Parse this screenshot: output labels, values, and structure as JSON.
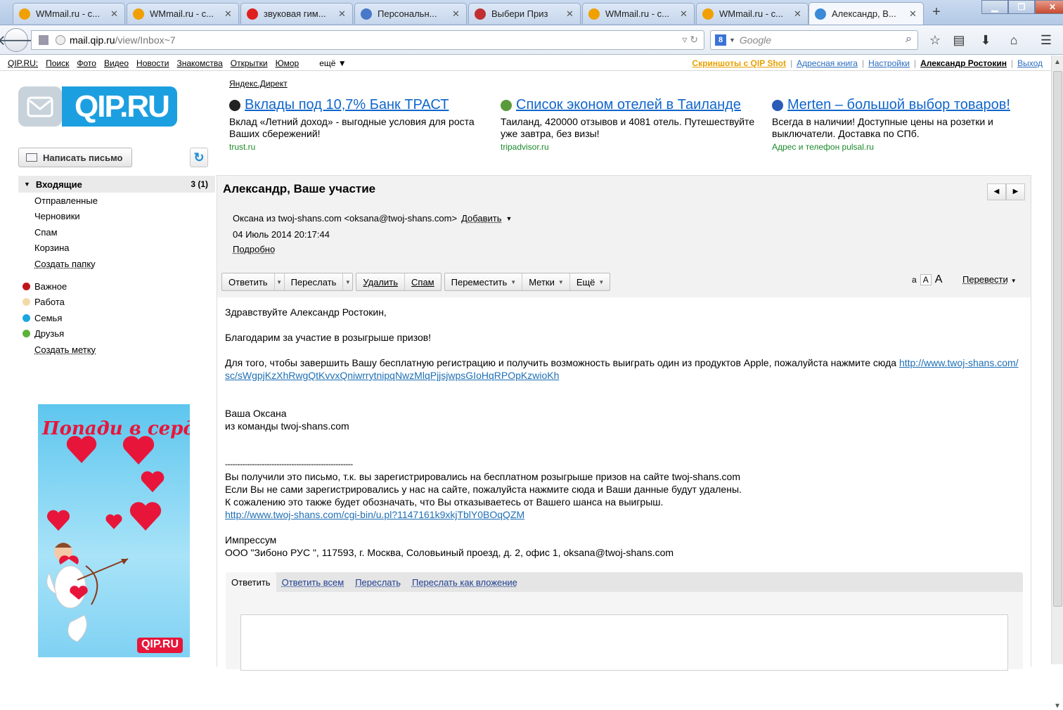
{
  "browser": {
    "tabs": [
      {
        "label": "WMmail.ru - с...",
        "icon": "wmmail-icon",
        "color": "#f0a000"
      },
      {
        "label": "WMmail.ru - с...",
        "icon": "wmmail-icon",
        "color": "#f0a000"
      },
      {
        "label": "звуковая гим...",
        "icon": "yandex-icon",
        "color": "#e02020"
      },
      {
        "label": "Персональн...",
        "icon": "personal-icon",
        "color": "#4a78c8"
      },
      {
        "label": "Выбери Приз",
        "icon": "prize-icon",
        "color": "#c03030"
      },
      {
        "label": "WMmail.ru - с...",
        "icon": "wmmail-icon",
        "color": "#f0a000"
      },
      {
        "label": "WMmail.ru - с...",
        "icon": "wmmail-icon",
        "color": "#f0a000"
      },
      {
        "label": "Александр, В...",
        "icon": "mail-icon",
        "color": "#3a8ad8",
        "active": true
      }
    ],
    "url_domain": "mail.qip.ru",
    "url_path": "/view/Inbox~7",
    "search_engine": "Google"
  },
  "topnav": {
    "left": [
      "QIP.RU:",
      "Поиск",
      "Фото",
      "Видео",
      "Новости",
      "Знакомства",
      "Открытки",
      "Юмор",
      "ещё ▼"
    ],
    "right": {
      "screenshots": "Скриншоты с QIP Shot",
      "addressbook": "Адресная книга",
      "settings": "Настройки",
      "user": "Александр Ростокин",
      "logout": "Выход"
    }
  },
  "logo": {
    "text": "QIP.RU"
  },
  "sidebar": {
    "compose": "Написать письмо",
    "inbox": {
      "label": "Входящие",
      "count": "3 (1)"
    },
    "folders": [
      "Отправленные",
      "Черновики",
      "Спам",
      "Корзина"
    ],
    "create_folder": "Создать папку",
    "labels": [
      {
        "name": "Важное",
        "color": "#c0141c"
      },
      {
        "name": "Работа",
        "color": "#f4d9a8"
      },
      {
        "name": "Семья",
        "color": "#1ca6e0"
      },
      {
        "name": "Друзья",
        "color": "#5cb338"
      }
    ],
    "create_label": "Создать метку",
    "promo_title": "Попади в сердце",
    "promo_logo": "QIP.RU"
  },
  "ads": {
    "header": "Яндекс.Директ",
    "items": [
      {
        "title": "Вклады под 10,7% Банк ТРАСТ",
        "text": "Вклад «Летний доход» - выгодные условия для роста Ваших сбережений!",
        "url": "trust.ru",
        "icon_color": "#222"
      },
      {
        "title": "Список эконом отелей в Таиланде",
        "text": "Таиланд, 420000 отзывов и 4081 отель. Путешествуйте уже завтра, без визы!",
        "url": "tripadvisor.ru",
        "icon_color": "#5a9a3a"
      },
      {
        "title": "Merten – большой выбор товаров!",
        "text": "Всегда в наличии! Доступные цены на розетки и выключатели. Доставка по СПб.",
        "url": "Адрес и телефон  pulsal.ru",
        "icon_color": "#2a5cb8"
      }
    ]
  },
  "message": {
    "subject": "Александр, Ваше участие",
    "sender": "Оксана из twoj-shans.com <oksana@twoj-shans.com>",
    "add_contact": "Добавить",
    "date": "04 Июль 2014 20:17:44",
    "details": "Подробно",
    "toolbar": {
      "reply": "Ответить",
      "forward": "Переслать",
      "delete": "Удалить",
      "spam": "Спам",
      "move": "Переместить",
      "tags": "Метки",
      "more": "Ещё"
    },
    "font_small": "а",
    "font_mid": "А",
    "font_large": "А",
    "translate": "Перевести",
    "body": {
      "greeting": "Здравствуйте Александр Ростокин,",
      "thanks": "Благодарим за участие в розыгрыше призов!",
      "instruction": "Для того, чтобы завершить Вашу бесплатную регистрацию и получить возможность выиграть один из продуктов Apple, пожалуйста нажмите сюда ",
      "link1": "http://www.twoj-shans.com/sc/sWgpjKzXhRwgQtKvvxQniwrrytnipqNwzMlqPjjsjwpsGIoHqRPOpKzwioKh",
      "sign1": "Ваша Оксана",
      "sign2": "из команды twoj-shans.com",
      "separator": "----------------------------------------------------",
      "footer1": "Вы получили это письмо, т.к. вы зарегистрировались на бесплатном розыгрыше призов на сайте twoj-shans.com",
      "footer2": "Если Вы не сами зарегистрировались у нас на сайте, пожалуйста нажмите сюда и Ваши данные будут удалены.",
      "footer3": "К сожалению это также будет обозначать, что Вы отказываетесь от Вашего шанса на выигрыш.",
      "link2": "http://www.twoj-shans.com/cgi-bin/u.pl?1147161k9xkjTblY0BOqQZM",
      "impressum": "Импрессум",
      "company": "ООО \"Зибоно РУС \", 117593, г. Москва, Соловьиный проезд, д. 2, офис 1, oksana@twoj-shans.com"
    },
    "reply_actions": [
      "Ответить",
      "Ответить всем",
      "Переслать",
      "Переслать как вложение"
    ]
  }
}
